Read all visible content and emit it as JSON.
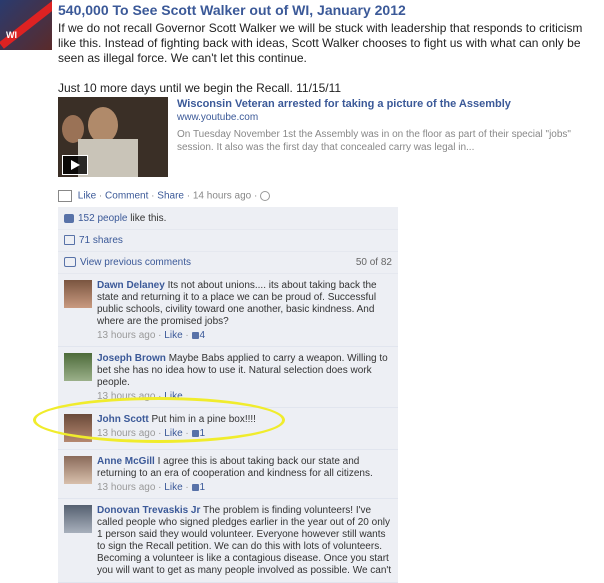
{
  "post": {
    "poster": "540,000 To See Scott Walker out of WI, January 2012",
    "text1": "If we do not recall Governor Scott Walker we will be stuck with leadership that responds to criticism like this. Instead of fighting back with ideas, Scott Walker chooses to fight us with what can only be seen as illegal force. We can't let this continue.",
    "text2": "Just 10 more days until we begin the Recall. 11/15/11"
  },
  "link": {
    "title": "Wisconsin Veteran arrested for taking a picture of the Assembly",
    "url": "www.youtube.com",
    "desc": "On Tuesday November 1st the Assembly was in on the floor as part of their special \"jobs\" session. It also was the first day that concealed carry was legal in..."
  },
  "actions": {
    "like": "Like",
    "comment": "Comment",
    "share": "Share",
    "time": "14 hours ago"
  },
  "ufi": {
    "likes_count": "152 people",
    "likes_suffix": "like this.",
    "shares": "71 shares",
    "view_previous": "View previous comments",
    "count": "50 of 82"
  },
  "comments": [
    {
      "name": "Dawn Delaney",
      "body": "Its not about unions.... its about taking back the state and returning it to a place we can be proud of. Successful public schools, civility toward one another, basic kindness. And where are the promised jobs?",
      "time": "13 hours ago",
      "like": "Like",
      "likes": "4"
    },
    {
      "name": "Joseph Brown",
      "body": "Maybe Babs applied to carry a weapon. Willing to bet she has no idea how to use it. Natural selection does work people.",
      "time": "13 hours ago",
      "like": "Like",
      "likes": ""
    },
    {
      "name": "John Scott",
      "body": "Put him in a pine box!!!!",
      "time": "13 hours ago",
      "like": "Like",
      "likes": "1"
    },
    {
      "name": "Anne McGill",
      "body": "I agree this is about taking back our state and returning to an era of cooperation and kindness for all citizens.",
      "time": "13 hours ago",
      "like": "Like",
      "likes": "1"
    },
    {
      "name": "Donovan Trevaskis Jr",
      "body": "The problem is finding volunteers! I've called people who signed pledges earlier in the year out of 20 only 1 person said they would volunteer. Everyone however still wants to sign the Recall petition. We can do this with lots of volunteers. Becoming a volunteer is like a contagious disease. Once you start you will want to get as many people involved as possible. We can't",
      "time": "",
      "like": "",
      "likes": ""
    }
  ],
  "colors": {
    "link": "#3b5998",
    "ufi_bg": "#edeff4",
    "highlight": "#f0ec2c"
  }
}
